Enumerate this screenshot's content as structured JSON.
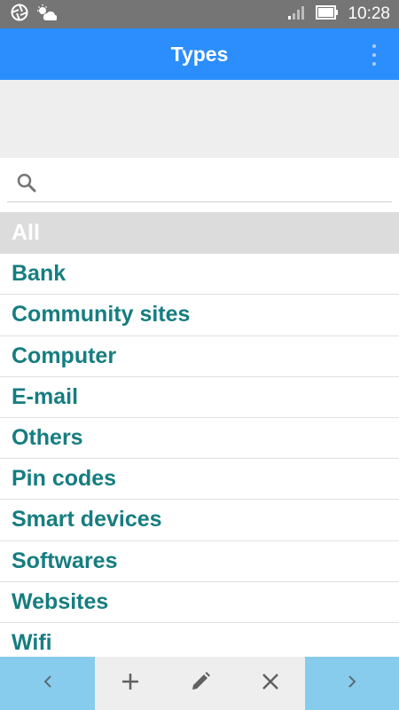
{
  "status_bar": {
    "time": "10:28",
    "icons": [
      "aperture-icon",
      "weather-icon",
      "signal-icon",
      "battery-icon"
    ]
  },
  "app_bar": {
    "title": "Types",
    "menu_icon": "overflow-menu-icon"
  },
  "search": {
    "placeholder": "",
    "value": "",
    "icon": "search-icon"
  },
  "types": [
    {
      "label": "All",
      "selected": true
    },
    {
      "label": "Bank",
      "selected": false
    },
    {
      "label": "Community sites",
      "selected": false
    },
    {
      "label": "Computer",
      "selected": false
    },
    {
      "label": "E-mail",
      "selected": false
    },
    {
      "label": "Others",
      "selected": false
    },
    {
      "label": "Pin codes",
      "selected": false
    },
    {
      "label": "Smart devices",
      "selected": false
    },
    {
      "label": "Softwares",
      "selected": false
    },
    {
      "label": "Websites",
      "selected": false
    },
    {
      "label": "Wifi",
      "selected": false
    }
  ],
  "bottom_bar": {
    "buttons": [
      "chevron-left-icon",
      "plus-icon",
      "pencil-icon",
      "close-icon",
      "chevron-right-icon"
    ]
  },
  "colors": {
    "app_bar": "#2b8efc",
    "status_bar": "#757575",
    "item_text": "#167d80",
    "selected_bg": "#dcdcdc",
    "nav_button_bg": "#87ccec"
  }
}
